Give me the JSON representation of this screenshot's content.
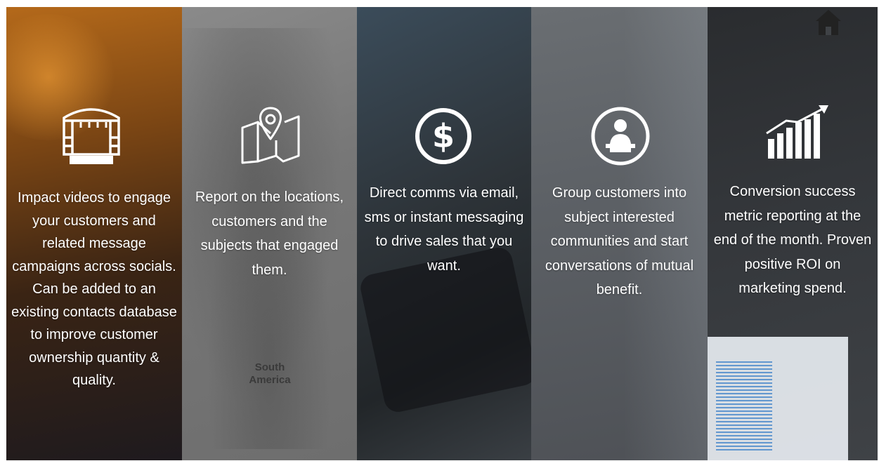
{
  "panels": [
    {
      "icon": "truck-stage-icon",
      "text": "Impact videos to engage your customers and related message campaigns across socials. Can be added to an existing contacts database to improve customer ownership quantity & quality."
    },
    {
      "icon": "map-pin-icon",
      "text": "Report on the locations, customers and the subjects that engaged them."
    },
    {
      "icon": "dollar-circle-icon",
      "text": "Direct comms via email, sms or instant messaging to drive sales that you want."
    },
    {
      "icon": "speaker-podium-icon",
      "text": "Group customers into subject interested communities and start conversations of mutual benefit."
    },
    {
      "icon": "growth-chart-icon",
      "text": "Conversion success metric reporting at the end of the month. Proven positive ROI on marketing spend."
    }
  ],
  "map_label": "South America",
  "home_icon": "home-icon",
  "colors": {
    "text": "#ffffff",
    "panel1_accent": "#b4691a"
  }
}
